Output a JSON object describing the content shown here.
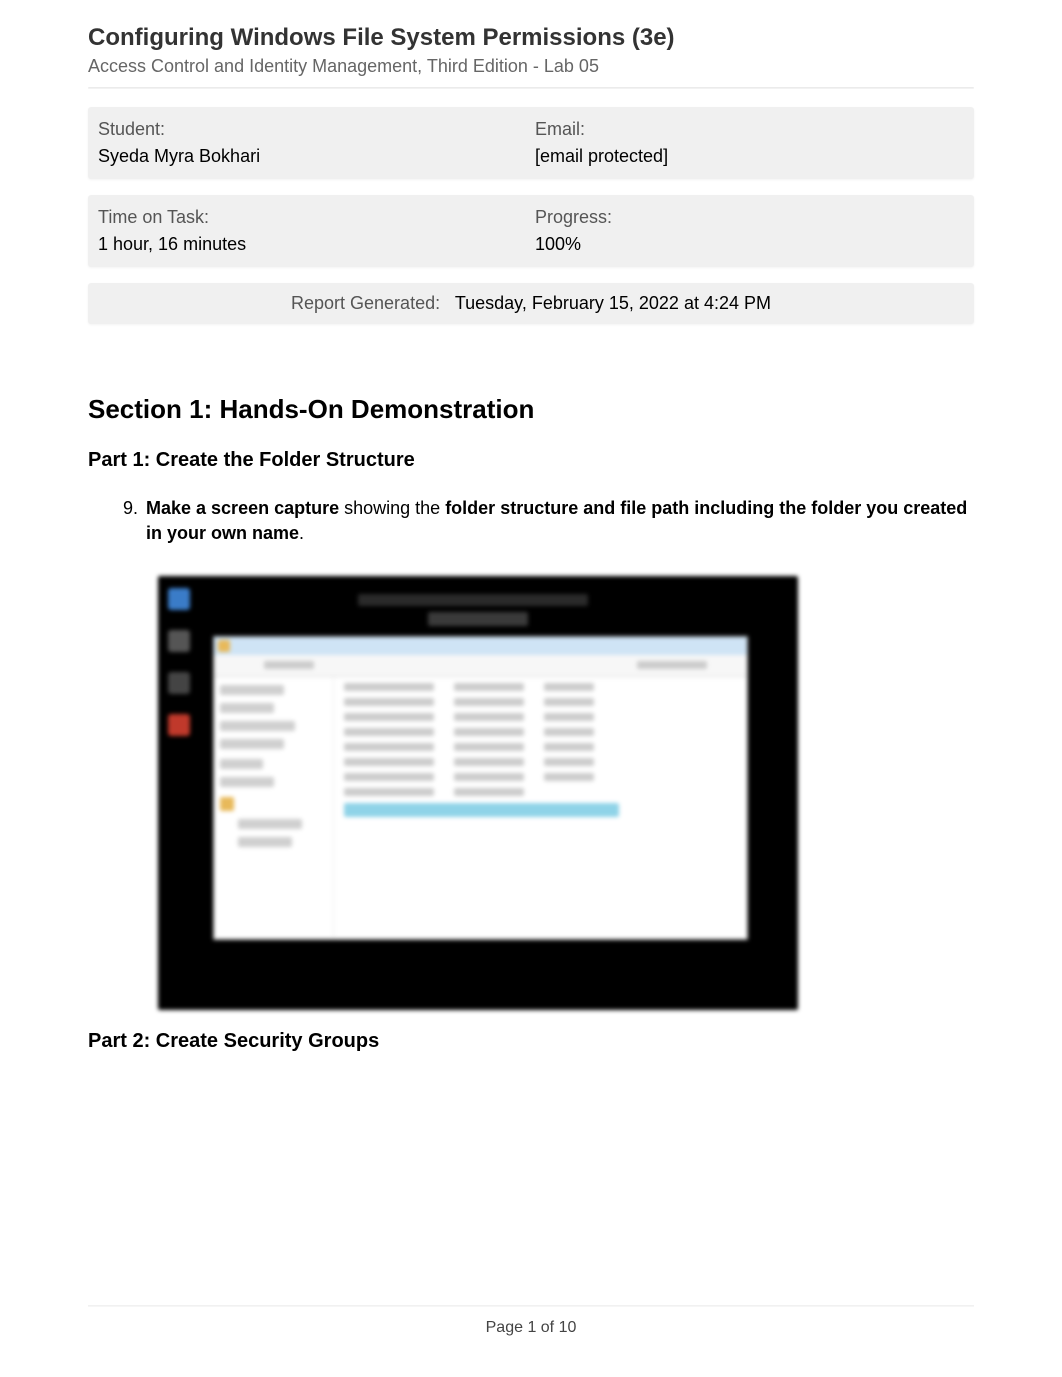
{
  "header": {
    "title": "Configuring Windows File System Permissions (3e)",
    "subtitle": "Access Control and Identity Management, Third Edition - Lab 05"
  },
  "info": {
    "student_label": "Student:",
    "student_value": "Syeda Myra Bokhari",
    "email_label": "Email:",
    "email_value": "[email protected]",
    "time_label": "Time on Task:",
    "time_value": "1 hour, 16 minutes",
    "progress_label": "Progress:",
    "progress_value": "100%"
  },
  "report": {
    "label": "Report Generated:",
    "value": "Tuesday, February 15, 2022 at 4:24 PM"
  },
  "section1": {
    "heading": "Section 1: Hands-On Demonstration",
    "part1_heading": "Part 1: Create the Folder Structure",
    "task_number": "9.",
    "task_b1": "Make a screen capture",
    "task_mid": " showing the ",
    "task_b2": "folder structure and file path including the folder you created in your own name",
    "task_end": ".",
    "part2_heading": "Part 2: Create Security Groups"
  },
  "footer": {
    "page": "Page 1 of 10"
  }
}
